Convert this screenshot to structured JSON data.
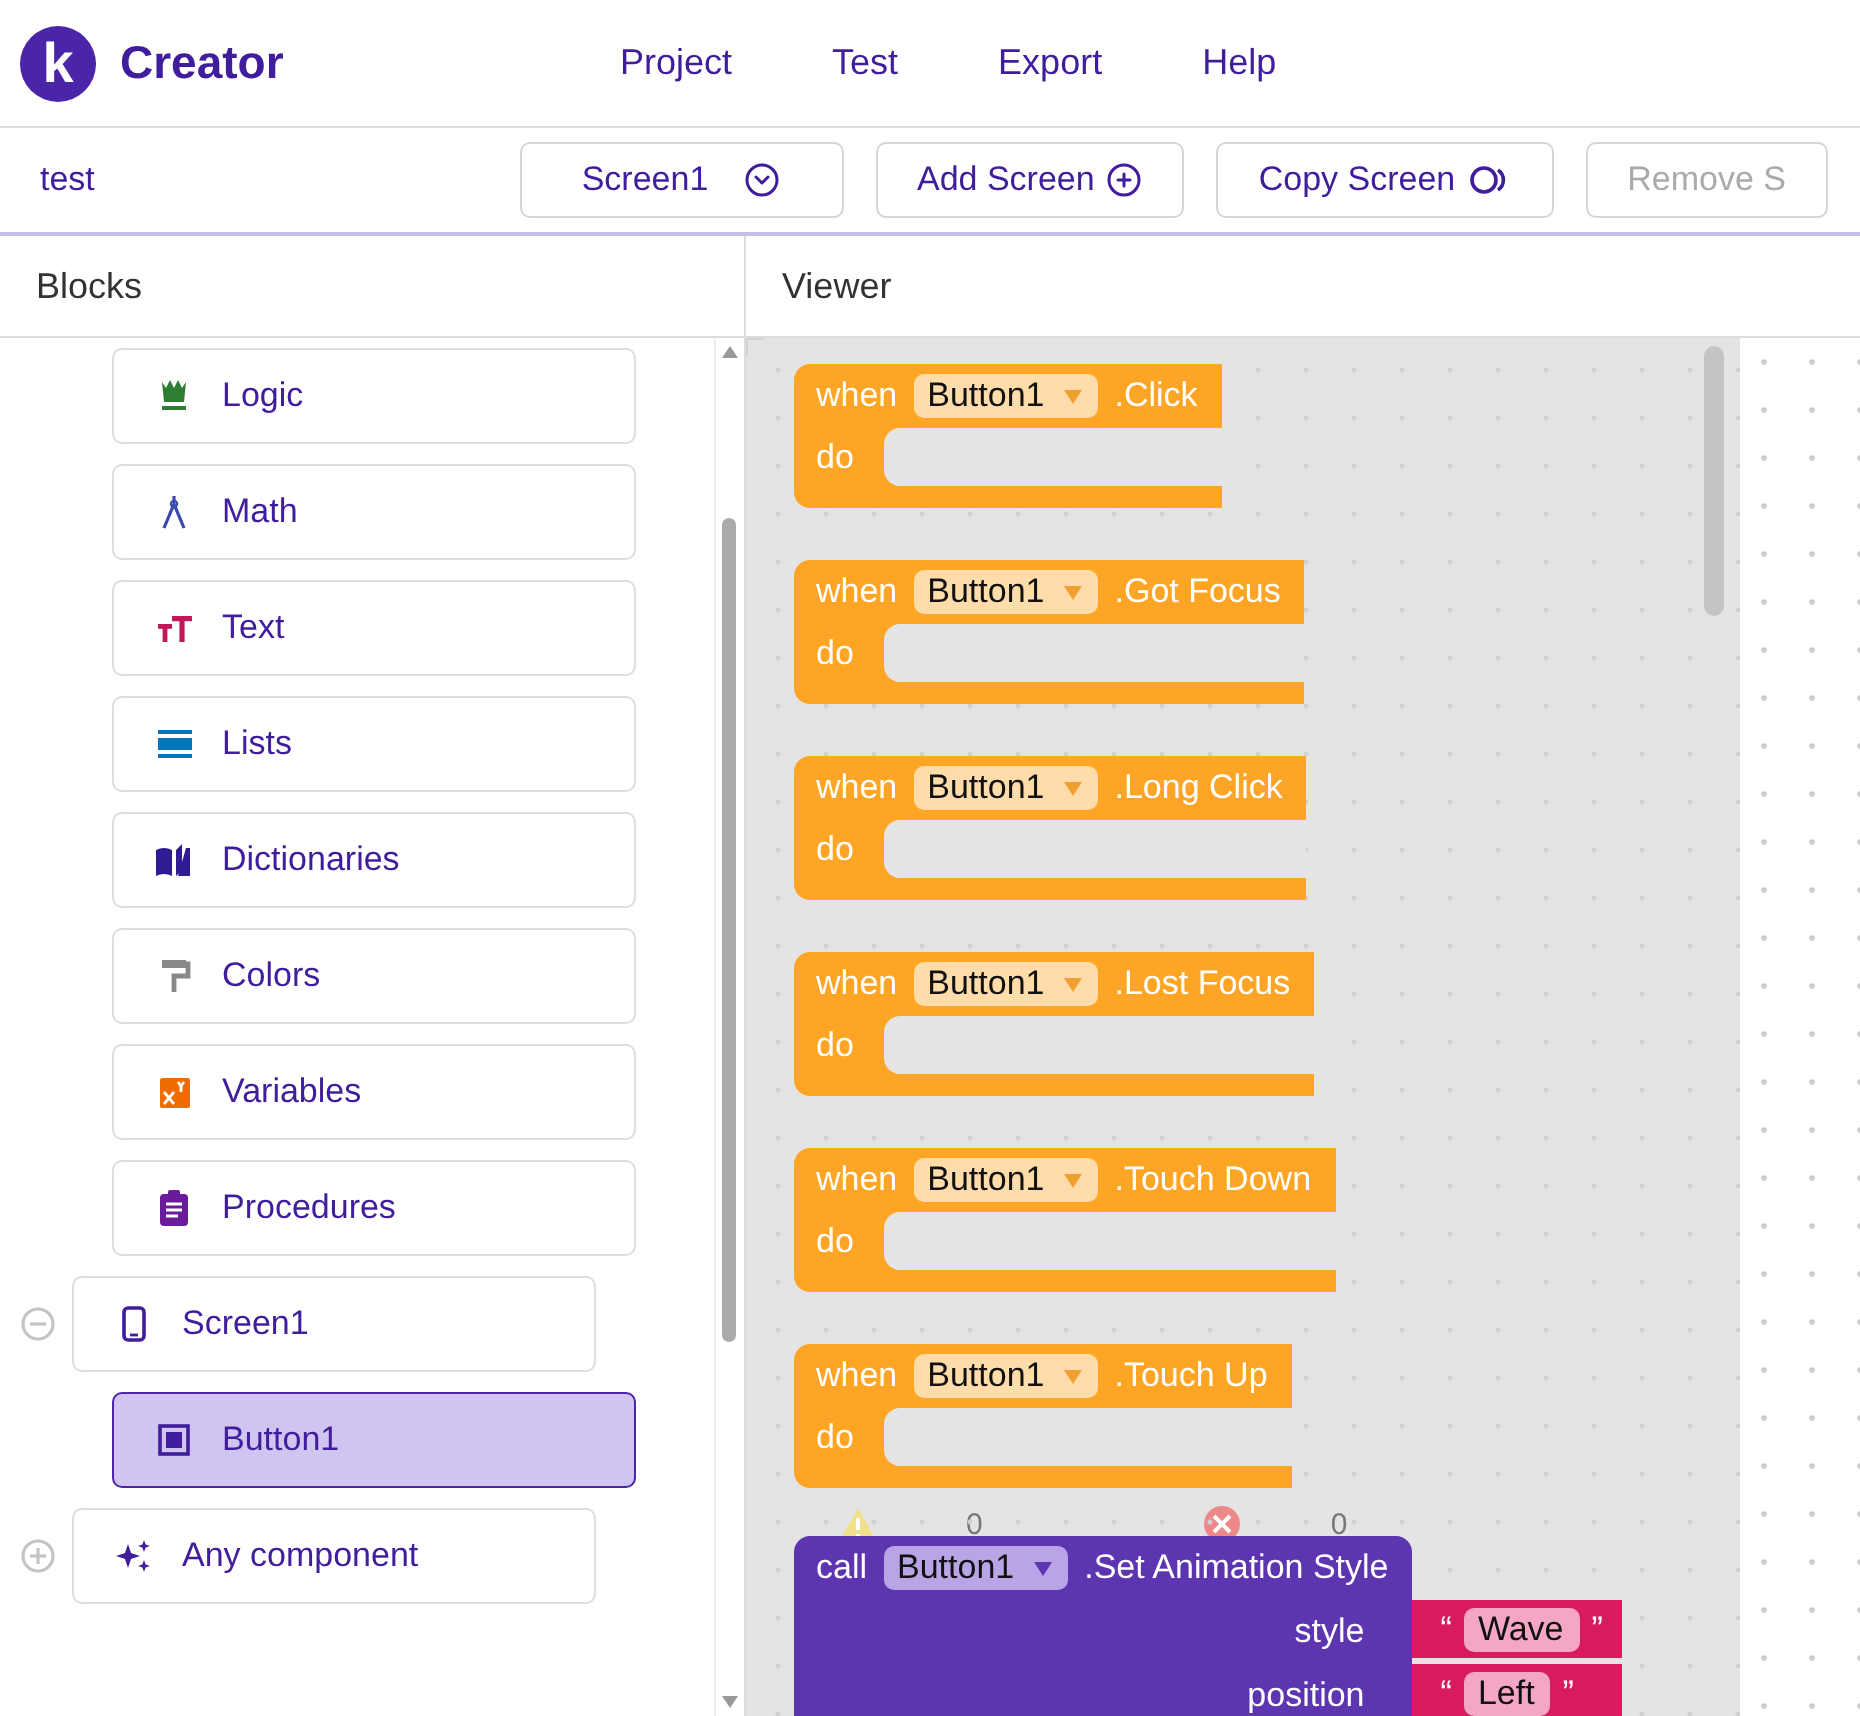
{
  "app": {
    "logo_letter": "k",
    "name": "Creator"
  },
  "menu": [
    "Project",
    "Test",
    "Export",
    "Help"
  ],
  "toolbar": {
    "project": "test",
    "screen_select": "Screen1",
    "buttons": [
      {
        "label": "Add Screen",
        "kind": "add",
        "disabled": false
      },
      {
        "label": "Copy Screen",
        "kind": "copy",
        "disabled": false
      },
      {
        "label": "Remove S",
        "kind": "none",
        "disabled": true
      }
    ]
  },
  "blocks_panel": {
    "title": "Blocks",
    "categories": [
      {
        "label": "Logic",
        "kind": "logic",
        "selected": false
      },
      {
        "label": "Math",
        "kind": "math",
        "selected": false
      },
      {
        "label": "Text",
        "kind": "text",
        "selected": false
      },
      {
        "label": "Lists",
        "kind": "lists",
        "selected": false
      },
      {
        "label": "Dictionaries",
        "kind": "dictionaries",
        "selected": false
      },
      {
        "label": "Colors",
        "kind": "colors",
        "selected": false
      },
      {
        "label": "Variables",
        "kind": "variables",
        "selected": false
      },
      {
        "label": "Procedures",
        "kind": "procedures",
        "selected": false
      }
    ],
    "tree": [
      {
        "label": "Screen1",
        "kind": "screen",
        "expanded": true,
        "selected": false,
        "children": [
          {
            "label": "Button1",
            "kind": "button",
            "selected": true
          }
        ]
      },
      {
        "label": "Any component",
        "kind": "any",
        "expanded": false,
        "selected": false
      }
    ]
  },
  "viewer": {
    "title": "Viewer",
    "event_blocks": [
      {
        "keyword": "when",
        "component": "Button1",
        "event": ".Click",
        "body": "do"
      },
      {
        "keyword": "when",
        "component": "Button1",
        "event": ".Got Focus",
        "body": "do"
      },
      {
        "keyword": "when",
        "component": "Button1",
        "event": ".Long Click",
        "body": "do"
      },
      {
        "keyword": "when",
        "component": "Button1",
        "event": ".Lost Focus",
        "body": "do"
      },
      {
        "keyword": "when",
        "component": "Button1",
        "event": ".Touch Down",
        "body": "do"
      },
      {
        "keyword": "when",
        "component": "Button1",
        "event": ".Touch Up",
        "body": "do"
      }
    ],
    "warnings": "0",
    "errors": "0",
    "call_block": {
      "keyword": "call",
      "component": "Button1",
      "method": ".Set Animation Style",
      "args": [
        {
          "name": "style",
          "open_quote": "“",
          "value": "Wave",
          "close_quote": "”"
        },
        {
          "name": "position",
          "open_quote": "“",
          "value": "Left",
          "close_quote": "”"
        }
      ]
    }
  }
}
